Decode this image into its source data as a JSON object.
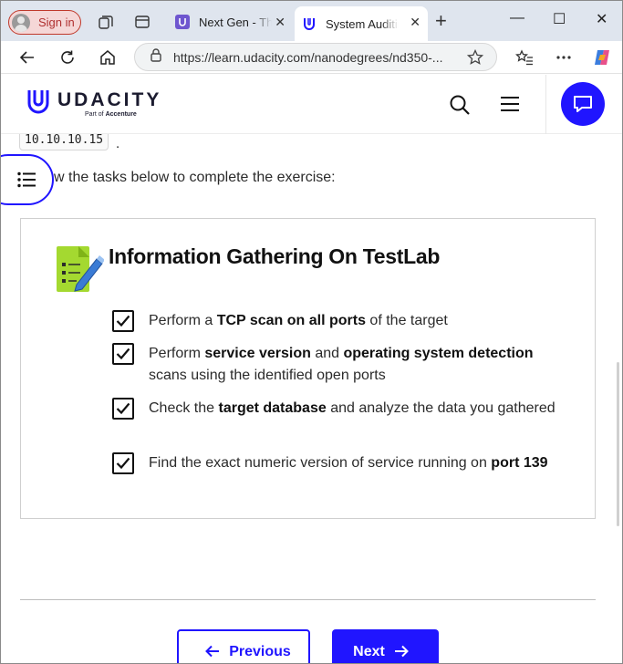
{
  "browser": {
    "sign_in_label": "Sign in",
    "tabs": [
      {
        "title": "Next Gen - The",
        "active": false
      },
      {
        "title": "System Auditin",
        "active": true
      }
    ],
    "new_tab": "+",
    "window_controls": {
      "minimize": "—",
      "maximize": "☐",
      "close": "✕"
    },
    "url": "https://learn.udacity.com/nanodegrees/nd350-...",
    "accent": "#2015ff"
  },
  "site": {
    "brand": "UDACITY",
    "brand_sub_prefix": "Part of",
    "brand_sub_company": "Accenture"
  },
  "content": {
    "ip_address": "10.10.10.15",
    "ip_trailing": ".",
    "instruction": "w the tasks below to complete the exercise:",
    "box_title": "Information Gathering On TestLab",
    "tasks": [
      {
        "parts": [
          {
            "t": "Perform a ",
            "b": false
          },
          {
            "t": "TCP scan on all ports",
            "b": true
          },
          {
            "t": " of the target",
            "b": false
          }
        ]
      },
      {
        "parts": [
          {
            "t": "Perform ",
            "b": false
          },
          {
            "t": "service version",
            "b": true
          },
          {
            "t": " and ",
            "b": false
          },
          {
            "t": "operating system detection",
            "b": true
          },
          {
            "t": " scans using the identified open ports",
            "b": false
          }
        ]
      },
      {
        "parts": [
          {
            "t": "Check the ",
            "b": false
          },
          {
            "t": "target database",
            "b": true
          },
          {
            "t": " and analyze the data you gathered",
            "b": false
          }
        ]
      },
      {
        "parts": [
          {
            "t": "Find the exact numeric version of service running on ",
            "b": false
          },
          {
            "t": "port 139",
            "b": true
          }
        ]
      }
    ],
    "prev_label": "Previous",
    "next_label": "Next"
  }
}
